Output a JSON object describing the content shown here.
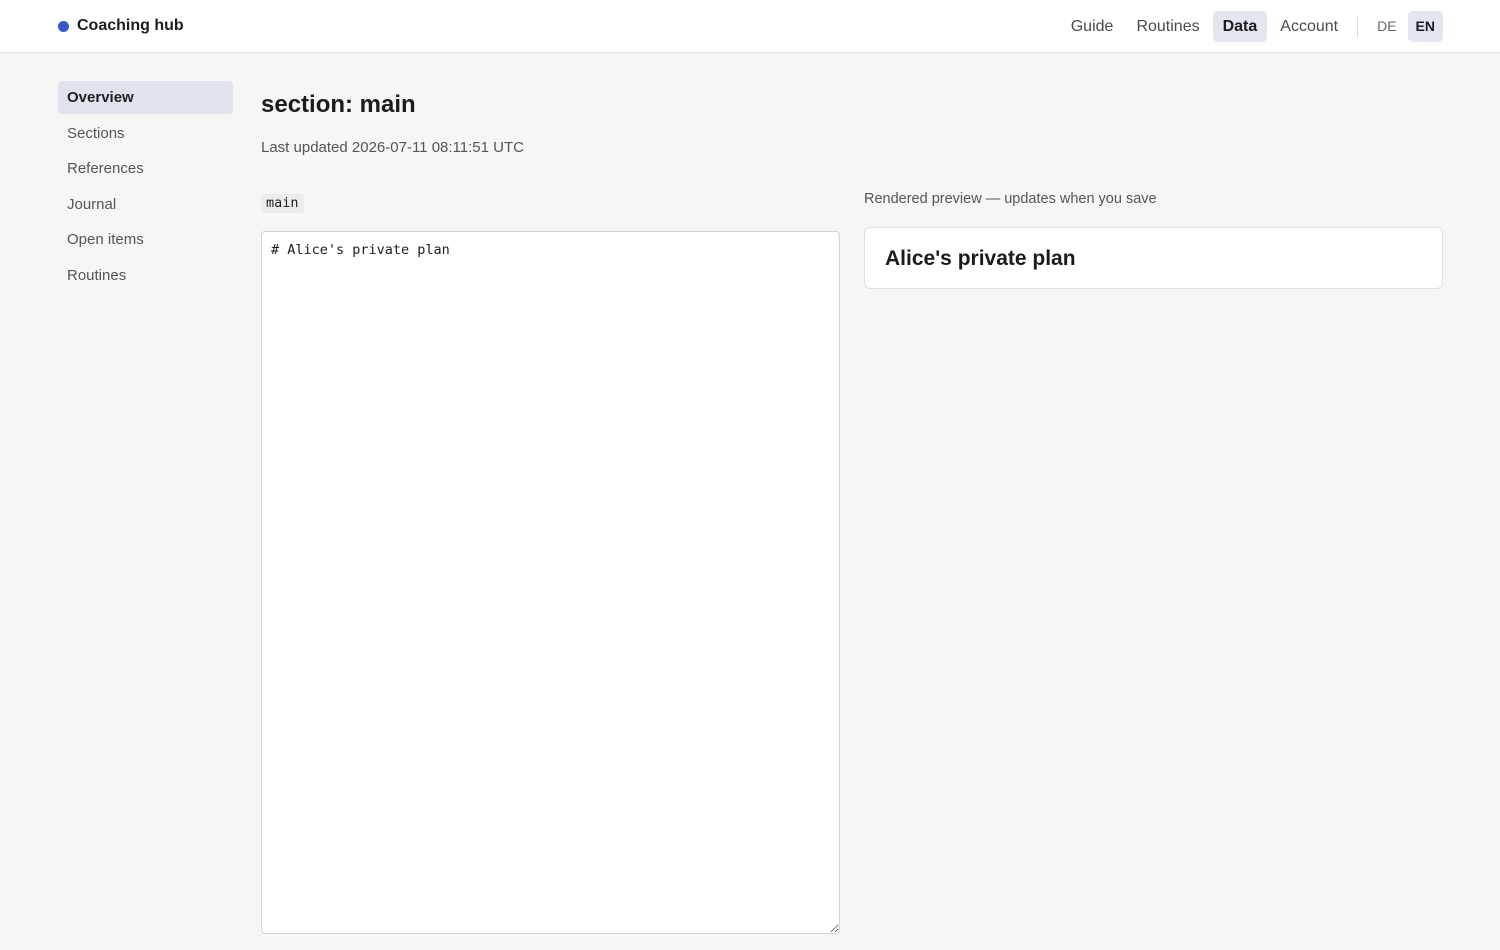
{
  "brand": {
    "name": "Coaching hub",
    "dot_color": "#3a57c7"
  },
  "topnav": {
    "items": [
      {
        "label": "Guide"
      },
      {
        "label": "Routines"
      },
      {
        "label": "Data",
        "active": true
      },
      {
        "label": "Account"
      }
    ],
    "languages": [
      {
        "label": "DE"
      },
      {
        "label": "EN",
        "active": true
      }
    ]
  },
  "sidebar": {
    "items": [
      {
        "label": "Overview",
        "active": true
      },
      {
        "label": "Sections"
      },
      {
        "label": "References"
      },
      {
        "label": "Journal"
      },
      {
        "label": "Open items"
      },
      {
        "label": "Routines"
      }
    ]
  },
  "main": {
    "title": "section: main",
    "last_updated": "Last updated 2026-07-11 08:11:51 UTC",
    "section_key": "main",
    "editor_value": "# Alice's private plan",
    "preview_label": "Rendered preview — updates when you save",
    "preview_heading": "Alice's private plan"
  }
}
